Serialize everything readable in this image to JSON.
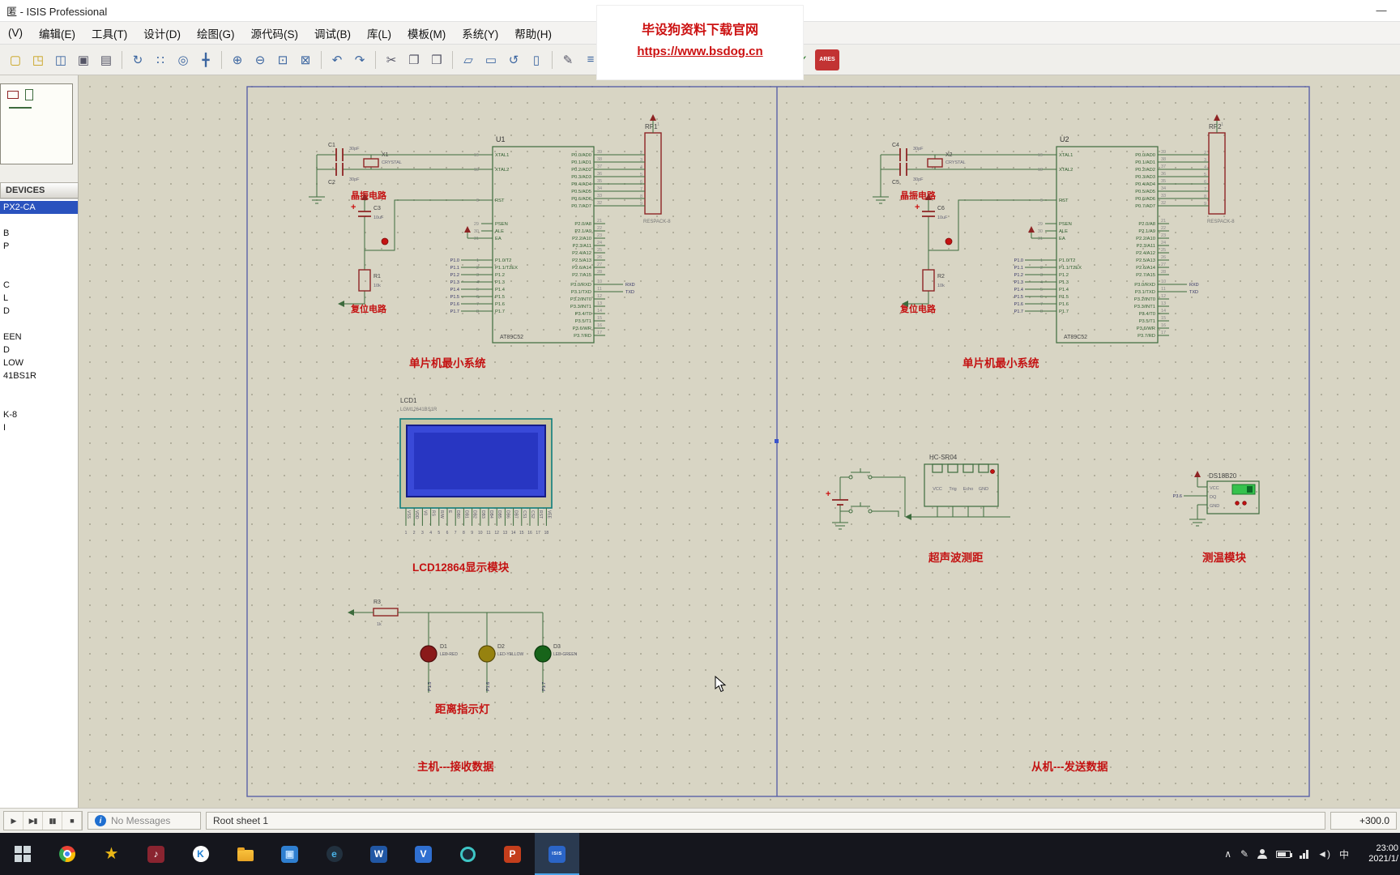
{
  "window": {
    "title": "匿 - ISIS Professional",
    "minimize": "—",
    "maximize": "▢",
    "close": "✕"
  },
  "menu": {
    "items": [
      "(V)",
      "编辑(E)",
      "工具(T)",
      "设计(D)",
      "绘图(G)",
      "源代码(S)",
      "调试(B)",
      "库(L)",
      "模板(M)",
      "系统(Y)",
      "帮助(H)"
    ]
  },
  "toolbar": {
    "buttons": [
      {
        "name": "new-design",
        "g": "▢",
        "c": "#c8a21a"
      },
      {
        "name": "open-design",
        "g": "◳",
        "c": "#c8a21a"
      },
      {
        "name": "save-design",
        "g": "◫",
        "c": "#3c66a0"
      },
      {
        "name": "print-design",
        "g": "▣",
        "c": "#556"
      },
      {
        "name": "mark-output-area",
        "g": "▤",
        "c": "#556"
      },
      {
        "sep": 1
      },
      {
        "name": "redraw",
        "g": "↻",
        "c": "#3c66a0"
      },
      {
        "name": "toggle-grid",
        "g": "∷",
        "c": "#3c66a0"
      },
      {
        "name": "origin",
        "g": "◎",
        "c": "#3c66a0"
      },
      {
        "name": "pan",
        "g": "╋",
        "c": "#3c66a0"
      },
      {
        "sep": 1
      },
      {
        "name": "zoom-in",
        "g": "⊕",
        "c": "#3c66a0"
      },
      {
        "name": "zoom-out",
        "g": "⊖",
        "c": "#3c66a0"
      },
      {
        "name": "zoom-area",
        "g": "⊡",
        "c": "#3c66a0"
      },
      {
        "name": "zoom-all",
        "g": "⊠",
        "c": "#3c66a0"
      },
      {
        "sep": 1
      },
      {
        "name": "undo",
        "g": "↶",
        "c": "#3c66a0"
      },
      {
        "name": "redo",
        "g": "↷",
        "c": "#3c66a0"
      },
      {
        "sep": 1
      },
      {
        "name": "cut",
        "g": "✂",
        "c": "#556"
      },
      {
        "name": "copy",
        "g": "❐",
        "c": "#556"
      },
      {
        "name": "paste",
        "g": "❒",
        "c": "#556"
      },
      {
        "sep": 1
      },
      {
        "name": "block-copy",
        "g": "▱",
        "c": "#3c66a0"
      },
      {
        "name": "block-move",
        "g": "▭",
        "c": "#3c66a0"
      },
      {
        "name": "block-rotate",
        "g": "↺",
        "c": "#3c66a0"
      },
      {
        "name": "block-delete",
        "g": "▯",
        "c": "#3c66a0"
      },
      {
        "sep": 1
      },
      {
        "name": "edit-properties",
        "g": "✎",
        "c": "#556"
      },
      {
        "name": "design-explorer",
        "g": "≡",
        "c": "#3c66a0"
      },
      {
        "name": "new-sheet",
        "g": "⊞",
        "c": "#3c66a0"
      },
      {
        "gap": 176
      },
      {
        "name": "bill-of-materials",
        "g": "$",
        "c": "#2a7a2a"
      },
      {
        "name": "electrical-rules-check",
        "g": "✓",
        "c": "#2a7a2a"
      },
      {
        "name": "netlist-to-ares",
        "g": "ARES",
        "ares": 1
      }
    ]
  },
  "watermark": {
    "line1": "毕设狗资料下载官网",
    "line2": "https://www.bsdog.cn"
  },
  "sidebar": {
    "devices_header": "DEVICES",
    "selected_index": 0,
    "items": [
      "PX2-CA",
      "",
      "B",
      "P",
      "",
      "",
      "C",
      "L",
      "D",
      "",
      "EEN",
      "D",
      "LOW",
      "41BS1R",
      "",
      "",
      "K-8",
      "I"
    ]
  },
  "schematic": {
    "captions": {
      "crystal": "晶振电路",
      "reset": "复位电路",
      "mcu": "单片机最小系统",
      "lcd": "LCD12864显示模块",
      "led": "距离指示灯",
      "sonar": "超声波测距",
      "temp": "测温模块",
      "master": "主机---接收数据",
      "slave": "从机---发送数据"
    },
    "components": {
      "u1": {
        "ref": "U1",
        "value": "AT89C52"
      },
      "u2": {
        "ref": "U2",
        "value": "AT89C52"
      },
      "rp1": {
        "ref": "RP1",
        "value": "RESPACK-8"
      },
      "rp2": {
        "ref": "RP2",
        "value": "RESPACK-8"
      },
      "c1": {
        "ref": "C1",
        "value": "30pF"
      },
      "c2": {
        "ref": "C2",
        "value": "30pF"
      },
      "c3": {
        "ref": "C3",
        "value": "10uF"
      },
      "c4": {
        "ref": "C4",
        "value": "30pF"
      },
      "c5": {
        "ref": "C5",
        "value": "30pF"
      },
      "c6": {
        "ref": "C6",
        "value": "10uF"
      },
      "x1": {
        "ref": "X1",
        "value": "CRYSTAL"
      },
      "x2": {
        "ref": "X2",
        "value": "CRYSTAL"
      },
      "r1": {
        "ref": "R1",
        "value": "10k"
      },
      "r2": {
        "ref": "R2",
        "value": "10k"
      },
      "r3": {
        "ref": "R3",
        "value": "1k"
      },
      "d1": {
        "ref": "D1",
        "value": "LED-RED"
      },
      "d2": {
        "ref": "D2",
        "value": "LED-YELLOW"
      },
      "d3": {
        "ref": "D3",
        "value": "LED-GREEN"
      },
      "lcd": {
        "ref": "LCD1",
        "value": "LGM12641BS1R"
      },
      "sonar": {
        "ref": "HC-SR04",
        "pins": [
          "VCC",
          "Trig",
          "Echo",
          "GND"
        ]
      },
      "temp": {
        "ref": "DS18B20",
        "pins": [
          "VCC",
          "DQ",
          "GND"
        ]
      }
    },
    "mcu_pins": {
      "left": [
        {
          "n": "19",
          "l": "XTAL1"
        },
        {
          "n": "18",
          "l": "XTAL2"
        },
        {
          "n": "9",
          "l": "RST"
        },
        {
          "n": "29",
          "l": "PSEN"
        },
        {
          "n": "30",
          "l": "ALE"
        },
        {
          "n": "31",
          "l": "EA"
        },
        {
          "n": "1",
          "l": "P1.0/T2"
        },
        {
          "n": "2",
          "l": "P1.1/T2EX"
        },
        {
          "n": "3",
          "l": "P1.2"
        },
        {
          "n": "4",
          "l": "P1.3"
        },
        {
          "n": "5",
          "l": "P1.4"
        },
        {
          "n": "6",
          "l": "P1.5"
        },
        {
          "n": "7",
          "l": "P1.6"
        },
        {
          "n": "8",
          "l": "P1.7"
        }
      ],
      "right": [
        {
          "n": "39",
          "l": "P0.0/AD0"
        },
        {
          "n": "38",
          "l": "P0.1/AD1"
        },
        {
          "n": "37",
          "l": "P0.2/AD2"
        },
        {
          "n": "36",
          "l": "P0.3/AD3"
        },
        {
          "n": "35",
          "l": "P0.4/AD4"
        },
        {
          "n": "34",
          "l": "P0.5/AD5"
        },
        {
          "n": "33",
          "l": "P0.6/AD6"
        },
        {
          "n": "32",
          "l": "P0.7/AD7"
        },
        {
          "n": "21",
          "l": "P2.0/A8"
        },
        {
          "n": "22",
          "l": "P2.1/A9"
        },
        {
          "n": "23",
          "l": "P2.2/A10"
        },
        {
          "n": "24",
          "l": "P2.3/A11"
        },
        {
          "n": "25",
          "l": "P2.4/A12"
        },
        {
          "n": "26",
          "l": "P2.5/A13"
        },
        {
          "n": "27",
          "l": "P2.6/A14"
        },
        {
          "n": "28",
          "l": "P2.7/A15"
        },
        {
          "n": "10",
          "l": "P3.0/RXD"
        },
        {
          "n": "11",
          "l": "P3.1/TXD"
        },
        {
          "n": "12",
          "l": "P3.2/INT0"
        },
        {
          "n": "13",
          "l": "P3.3/INT1"
        },
        {
          "n": "14",
          "l": "P3.4/T0"
        },
        {
          "n": "15",
          "l": "P3.5/T1"
        },
        {
          "n": "16",
          "l": "P3.6/WR"
        },
        {
          "n": "17",
          "l": "P3.7/RD"
        }
      ]
    },
    "lcd_pins": [
      "VSS",
      "VDD",
      "V0",
      "RS",
      "R/W",
      "E",
      "DB0",
      "DB1",
      "DB2",
      "DB3",
      "DB4",
      "DB5",
      "DB6",
      "DB7",
      "CS1",
      "CS2",
      "RST",
      "VEE"
    ],
    "nets": {
      "p1": [
        "P1.0",
        "P1.1",
        "P1.2",
        "P1.3",
        "P1.4",
        "P1.5",
        "P1.6",
        "P1.7"
      ],
      "serial": [
        "RXD",
        "TXD"
      ],
      "led": [
        "P1.5",
        "P1.6",
        "P1.7"
      ],
      "temp": "P3.6",
      "respack": [
        "2",
        "3",
        "4",
        "5",
        "6",
        "7",
        "8",
        "9"
      ],
      "respack_common": "1",
      "plus": "+"
    }
  },
  "statusbar": {
    "controls": [
      {
        "name": "play",
        "g": "▶"
      },
      {
        "name": "step",
        "g": "▶▮"
      },
      {
        "name": "pause",
        "g": "▮▮"
      },
      {
        "name": "stop",
        "g": "■"
      }
    ],
    "info": "i",
    "message": "No Messages",
    "sheet": "Root sheet 1",
    "coordinate": "+300.0"
  },
  "taskbar": {
    "icons": [
      {
        "name": "start-button",
        "type": "start"
      },
      {
        "name": "chrome-browser",
        "type": "chrome"
      },
      {
        "name": "favorites-app",
        "type": "glyph",
        "g": "★",
        "fg": "#e9b617"
      },
      {
        "name": "media-app",
        "type": "square",
        "g": "♪",
        "bg": "#8a2430",
        "fg": "#fff"
      },
      {
        "name": "kugou-music",
        "type": "circle",
        "g": "K",
        "bg": "#ffffff",
        "fg": "#1f7fd4"
      },
      {
        "name": "file-explorer",
        "type": "folder"
      },
      {
        "name": "app-window",
        "type": "square",
        "g": "▣",
        "bg": "#2f7fd0",
        "fg": "#bfe0ff"
      },
      {
        "name": "browser-app",
        "type": "circle",
        "g": "e",
        "bg": "#22313f",
        "fg": "#4ab3e8"
      },
      {
        "name": "word",
        "type": "square",
        "g": "W",
        "bg": "#2157a4",
        "fg": "#fff"
      },
      {
        "name": "v-app",
        "type": "square",
        "g": "V",
        "bg": "#2f6fd0",
        "fg": "#fff"
      },
      {
        "name": "edge-browser",
        "type": "ring",
        "bg": "#1b2a38",
        "fg": "#3ec6c6"
      },
      {
        "name": "powerpoint",
        "type": "square",
        "g": "P",
        "bg": "#c43e1c",
        "fg": "#fff"
      },
      {
        "name": "proteus-isis",
        "type": "square",
        "g": "ISIS",
        "bg": "#2b65c7",
        "fg": "#fff",
        "small": true,
        "active": true
      }
    ],
    "tray": {
      "expand": "∧",
      "pen": "✎",
      "volume": "◄)",
      "input": "中",
      "time": "23:00",
      "date": "2021/1/"
    }
  }
}
